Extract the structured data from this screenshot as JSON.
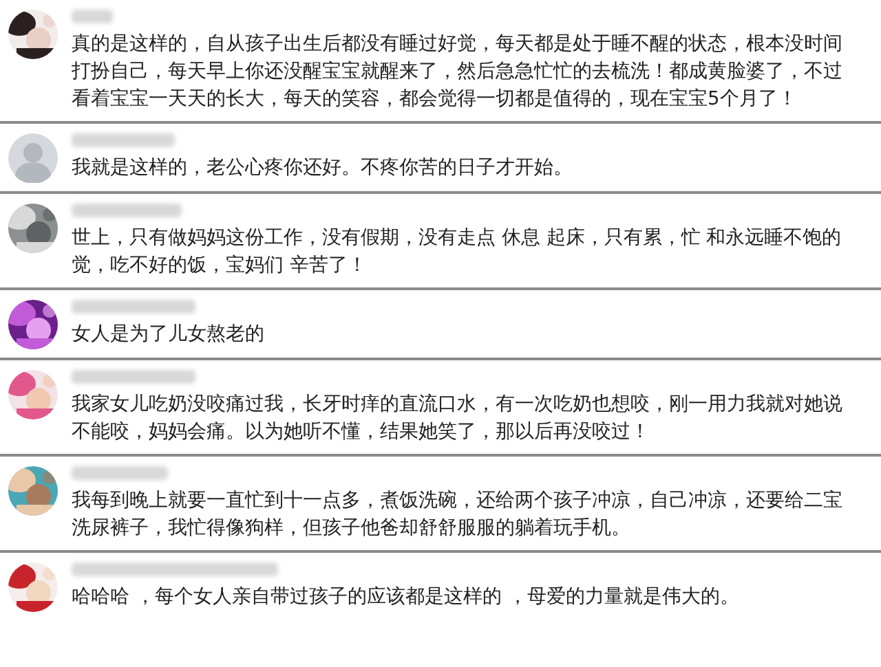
{
  "comments": [
    {
      "text": "真的是这样的，自从孩子出生后都没有睡过好觉，每天都是处于睡不醒的状态，根本没时间打扮自己，每天早上你还没醒宝宝就醒来了，然后急急忙忙的去梳洗！都成黄脸婆了，不过看着宝宝一天天的长大，每天的笑容，都会觉得一切都是值得的，现在宝宝5个月了！"
    },
    {
      "avatar": {
        "kind": "placeholder"
      },
      "text": "我就是这样的，老公心疼你还好。不疼你苦的日子才开始。"
    },
    {
      "text": "世上，只有做妈妈这份工作，没有假期，没有走点 休息 起床，只有累，忙 和永远睡不饱的觉，吃不好的饭，宝妈们 辛苦了！"
    },
    {
      "text": "女人是为了儿女熬老的"
    },
    {
      "text": "我家女儿吃奶没咬痛过我，长牙时痒的直流口水，有一次吃奶也想咬，刚一用力我就对她说不能咬，妈妈会痛。以为她听不懂，结果她笑了，那以后再没咬过！"
    },
    {
      "text": "我每到晚上就要一直忙到十一点多，煮饭洗碗，还给两个孩子冲凉，自己冲凉，还要给二宝洗尿裤子，我忙得像狗样，但孩子他爸却舒舒服服的躺着玩手机。"
    },
    {
      "text": "哈哈哈 ，每个女人亲自带过孩子的应该都是这样的 ，母爱的力量就是伟大的。"
    }
  ]
}
